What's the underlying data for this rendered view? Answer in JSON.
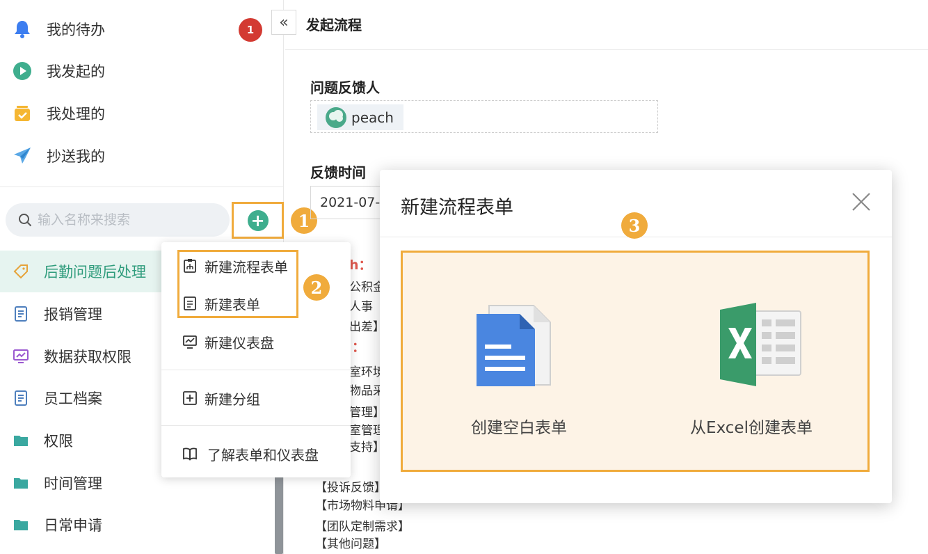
{
  "sidebar": {
    "nav": [
      {
        "label": "我的待办",
        "icon": "bell-icon",
        "badge": "1"
      },
      {
        "label": "我发起的",
        "icon": "play-circle-icon"
      },
      {
        "label": "我处理的",
        "icon": "inbox-check-icon"
      },
      {
        "label": "抄送我的",
        "icon": "paper-plane-icon"
      }
    ],
    "search_placeholder": "输入名称来搜索",
    "tree": [
      {
        "label": "后勤问题后处理",
        "icon": "tag-icon",
        "active": true
      },
      {
        "label": "报销管理",
        "icon": "document-icon"
      },
      {
        "label": "数据获取权限",
        "icon": "monitor-chart-icon"
      },
      {
        "label": "员工档案",
        "icon": "document-icon"
      },
      {
        "label": "权限",
        "icon": "folder-icon"
      },
      {
        "label": "时间管理",
        "icon": "folder-icon"
      },
      {
        "label": "日常申请",
        "icon": "folder-icon"
      }
    ]
  },
  "steps": {
    "one": "1",
    "two": "2",
    "three": "3"
  },
  "main": {
    "title": "发起流程",
    "reporter_label": "问题反馈人",
    "reporter_name": "peach",
    "time_label": "反馈时间",
    "date_value": "2021-07-",
    "bg_texts": [
      "h：",
      "公积金",
      "人事",
      "出差】",
      "：",
      "室环境",
      "物品采",
      "管理】",
      "室管理",
      "支持】",
      "【投诉反馈】",
      "【市场物料申请】",
      "【团队定制需求】",
      "【其他问题】"
    ]
  },
  "menu": {
    "items": [
      {
        "label": "新建流程表单",
        "icon": "flow-form-icon"
      },
      {
        "label": "新建表单",
        "icon": "form-icon"
      },
      {
        "label": "新建仪表盘",
        "icon": "dashboard-icon"
      },
      {
        "label": "新建分组",
        "icon": "add-group-icon"
      },
      {
        "label": "了解表单和仪表盘",
        "icon": "book-icon"
      }
    ]
  },
  "modal": {
    "title": "新建流程表单",
    "close": "×",
    "options": [
      {
        "label": "创建空白表单",
        "icon": "blank-doc-icon"
      },
      {
        "label": "从Excel创建表单",
        "icon": "excel-icon"
      }
    ]
  },
  "colors": {
    "accent": "#3fae8e",
    "highlight": "#f0ab3c",
    "badge": "#d33a32"
  }
}
